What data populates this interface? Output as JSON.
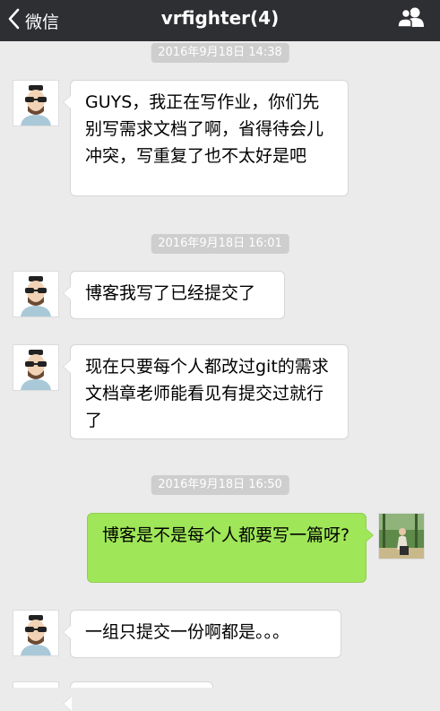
{
  "header": {
    "back_label": "微信",
    "title": "vrfighter(4)",
    "back_icon": "chevron-left-icon",
    "members_icon": "people-icon"
  },
  "timestamps": [
    "2016年9月18日 14:38",
    "2016年9月18日 16:01",
    "2016年9月18日 16:50"
  ],
  "messages": [
    {
      "sender": "other",
      "text": "GUYS，我正在写作业，你们先别写需求文档了啊，省得待会儿冲突，写重复了也不太好是吧"
    },
    {
      "sender": "other",
      "text": "博客我写了已经提交了"
    },
    {
      "sender": "other",
      "text": "现在只要每个人都改过git的需求文档章老师能看见有提交过就行了"
    },
    {
      "sender": "self",
      "text": "博客是不是每个人都要写一篇呀?"
    },
    {
      "sender": "other",
      "text": "一组只提交一份啊都是。。。"
    }
  ],
  "colors": {
    "header_bg": "#2e2f33",
    "chat_bg": "#ebebeb",
    "bubble_self": "#9fe658",
    "bubble_other": "#ffffff",
    "timestamp_bg": "#cecece"
  }
}
